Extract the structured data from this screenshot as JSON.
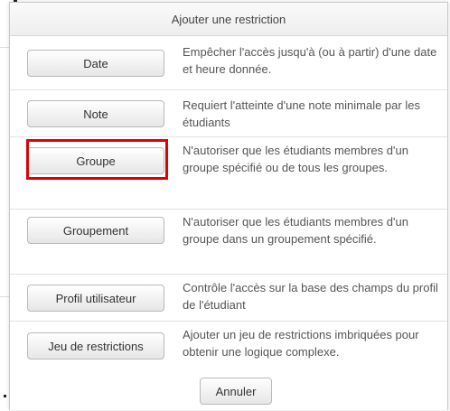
{
  "dialog": {
    "title": "Ajouter une restriction",
    "cancel_label": "Annuler",
    "options": [
      {
        "label": "Date",
        "description": "Empêcher l'accès jusqu'à (ou à partir) d'une date et heure donnée."
      },
      {
        "label": "Note",
        "description": "Requiert l'atteinte d'une note minimale par les étudiants"
      },
      {
        "label": "Groupe",
        "description": "N'autoriser que les étudiants membres d'un groupe spécifié ou de tous les groupes."
      },
      {
        "label": "Groupement",
        "description": "N'autoriser que les étudiants membres d'un groupe dans un groupement spécifié."
      },
      {
        "label": "Profil utilisateur",
        "description": "Contrôle l'accès sur la base des champs du profil de l'étudiant"
      },
      {
        "label": "Jeu de restrictions",
        "description": "Ajouter un jeu de restrictions imbriquées pour obtenir une logique complexe."
      }
    ],
    "highlight_color": "#e00000"
  }
}
